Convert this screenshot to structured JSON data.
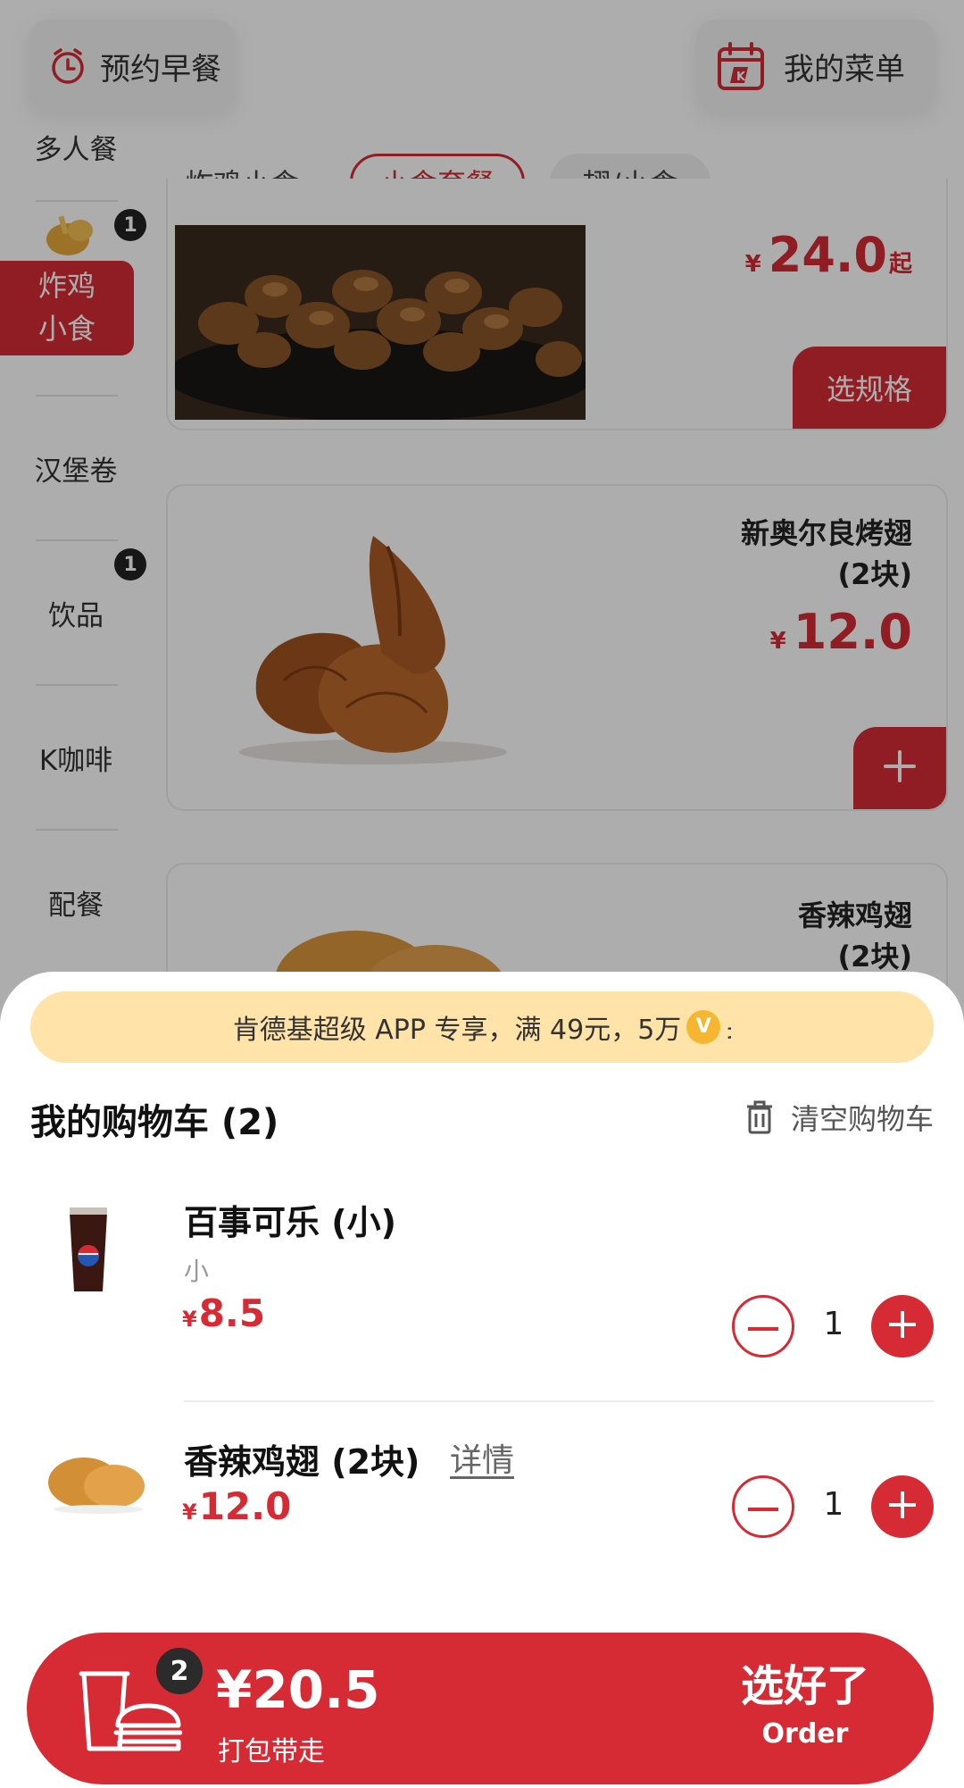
{
  "top_buttons": {
    "breakfast": "预约早餐",
    "my_menu": "我的菜单"
  },
  "sidebar": {
    "items": [
      {
        "label": "多人餐"
      },
      {
        "label": "炸鸡\n小食",
        "line1": "炸鸡",
        "line2": "小食",
        "badge": "1",
        "active": true
      },
      {
        "label": "汉堡卷"
      },
      {
        "label": "饮品",
        "badge": "1"
      },
      {
        "label": "K咖啡"
      },
      {
        "label": "配餐"
      }
    ]
  },
  "subtabs": [
    {
      "label": "炸鸡小食",
      "active": false
    },
    {
      "label": "小食套餐",
      "active": true
    },
    {
      "label": "翅/小食",
      "active": false
    }
  ],
  "products": [
    {
      "price_symbol": "¥",
      "price": "24.0",
      "price_suffix": "起",
      "action": "选规格"
    },
    {
      "name_line1": "新奥尔良烤翅",
      "name_line2": "(2块)",
      "price_symbol": "¥",
      "price": "12.0",
      "action": "+"
    },
    {
      "name_line1": "香辣鸡翅",
      "name_line2": "(2块)"
    }
  ],
  "promo_banner": "肯德基超级 APP 专享，满 49元，5万",
  "cart": {
    "title": "我的购物车 (2)",
    "clear_label": "清空购物车",
    "items": [
      {
        "name": "百事可乐 (小)",
        "spec": "小",
        "price_symbol": "¥",
        "price": "8.5",
        "qty": "1"
      },
      {
        "name": "香辣鸡翅 (2块)",
        "detail_link": "详情",
        "price_symbol": "¥",
        "price": "12.0",
        "qty": "1"
      }
    ]
  },
  "checkout": {
    "badge": "2",
    "total": "¥20.5",
    "mode": "打包带走",
    "confirm": "选好了",
    "confirm_en": "Order"
  },
  "colors": {
    "accent": "#d62b35",
    "banner_bg": "#ffe3a9",
    "overlay": "rgba(0,0,0,0.32)"
  }
}
